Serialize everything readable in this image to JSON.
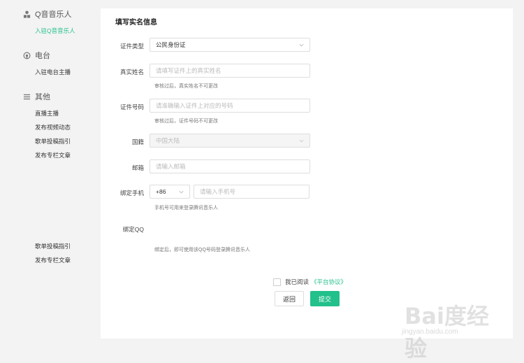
{
  "sidebar": {
    "sections": [
      {
        "title": "Q音音乐人",
        "icon": "person-icon",
        "links": [
          {
            "label": "入驻Q音音乐人",
            "active": true
          }
        ]
      },
      {
        "title": "电台",
        "icon": "radio-icon",
        "links": [
          {
            "label": "入驻电台主播",
            "active": false
          }
        ]
      },
      {
        "title": "其他",
        "icon": "menu-icon",
        "links": [
          {
            "label": "直播主播"
          },
          {
            "label": "发布视频动态"
          },
          {
            "label": "歌单投稿指引"
          },
          {
            "label": "发布专栏文章"
          }
        ]
      }
    ],
    "extra_links": [
      {
        "label": "歌单投稿指引"
      },
      {
        "label": "发布专栏文章"
      }
    ]
  },
  "form": {
    "title": "填写实名信息",
    "id_type": {
      "label": "证件类型",
      "value": "公民身份证"
    },
    "real_name": {
      "label": "真实姓名",
      "placeholder": "请填写证件上的真实姓名",
      "hint": "审核过后，真实姓名不可更改"
    },
    "id_number": {
      "label": "证件号码",
      "placeholder": "请准确输入证件上对应的号码",
      "hint": "审核过后，证件号码不可更改"
    },
    "nationality": {
      "label": "国籍",
      "value": "中国大陆"
    },
    "email": {
      "label": "邮箱",
      "placeholder": "请输入邮箱"
    },
    "phone": {
      "label": "绑定手机",
      "country_code": "+86",
      "placeholder": "请输入手机号",
      "hint": "手机号可用来登录腾讯音乐人"
    },
    "qq": {
      "label": "绑定QQ",
      "hint": "绑定后，即可使用该QQ号码登录腾讯音乐人"
    },
    "agreement": {
      "text": "我已阅读",
      "link": "《平台协议》"
    },
    "back_label": "返回",
    "submit_label": "提交"
  },
  "watermark": {
    "text": "Bai度经验",
    "sub": "jingyan.baidu.com"
  },
  "colors": {
    "accent": "#22c08a",
    "background": "#f3f3f3"
  }
}
